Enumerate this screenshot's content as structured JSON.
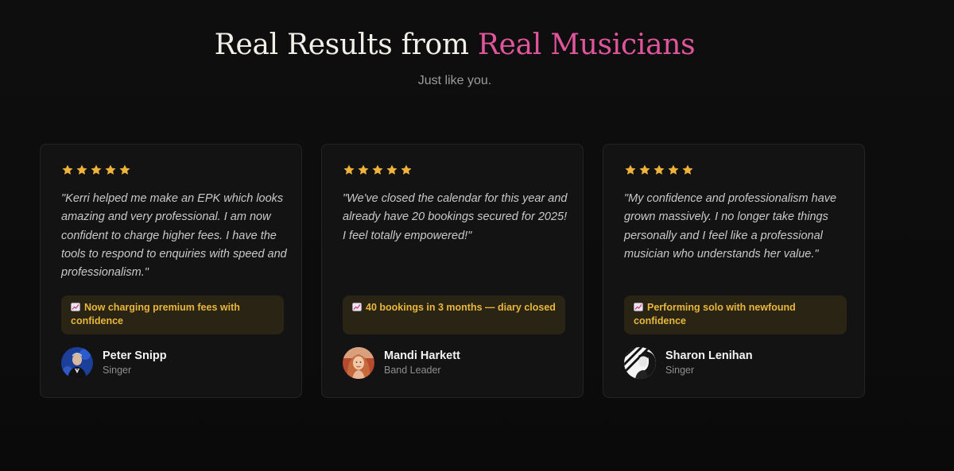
{
  "header": {
    "title_part1": "Real Results from ",
    "title_accent": "Real Musicians",
    "subtitle": "Just like you."
  },
  "colors": {
    "accent_pink": "#e0559c",
    "star_gold": "#f0b43a",
    "result_text": "#e8b73c",
    "background": "#0d0d0d"
  },
  "testimonials": [
    {
      "rating": 5,
      "quote": "\"Kerri helped me make an EPK which looks amazing and very professional. I am now confident to charge higher fees. I have the tools to respond to enquiries with speed and professionalism.\"",
      "result_icon": "chart-increasing-icon",
      "result": "Now charging premium fees with confidence",
      "name": "Peter Snipp",
      "role": "Singer"
    },
    {
      "rating": 5,
      "quote": "\"We've closed the calendar for this year and already have 20 bookings secured for 2025! I feel totally empowered!\"",
      "result_icon": "chart-increasing-icon",
      "result": "40 bookings in 3 months — diary closed",
      "name": "Mandi Harkett",
      "role": "Band Leader"
    },
    {
      "rating": 5,
      "quote": "\"My confidence and professionalism have grown massively. I no longer take things personally and I feel like a professional musician who understands her value.\"",
      "result_icon": "chart-increasing-icon",
      "result": "Performing solo with newfound confidence",
      "name": "Sharon Lenihan",
      "role": "Singer"
    }
  ]
}
